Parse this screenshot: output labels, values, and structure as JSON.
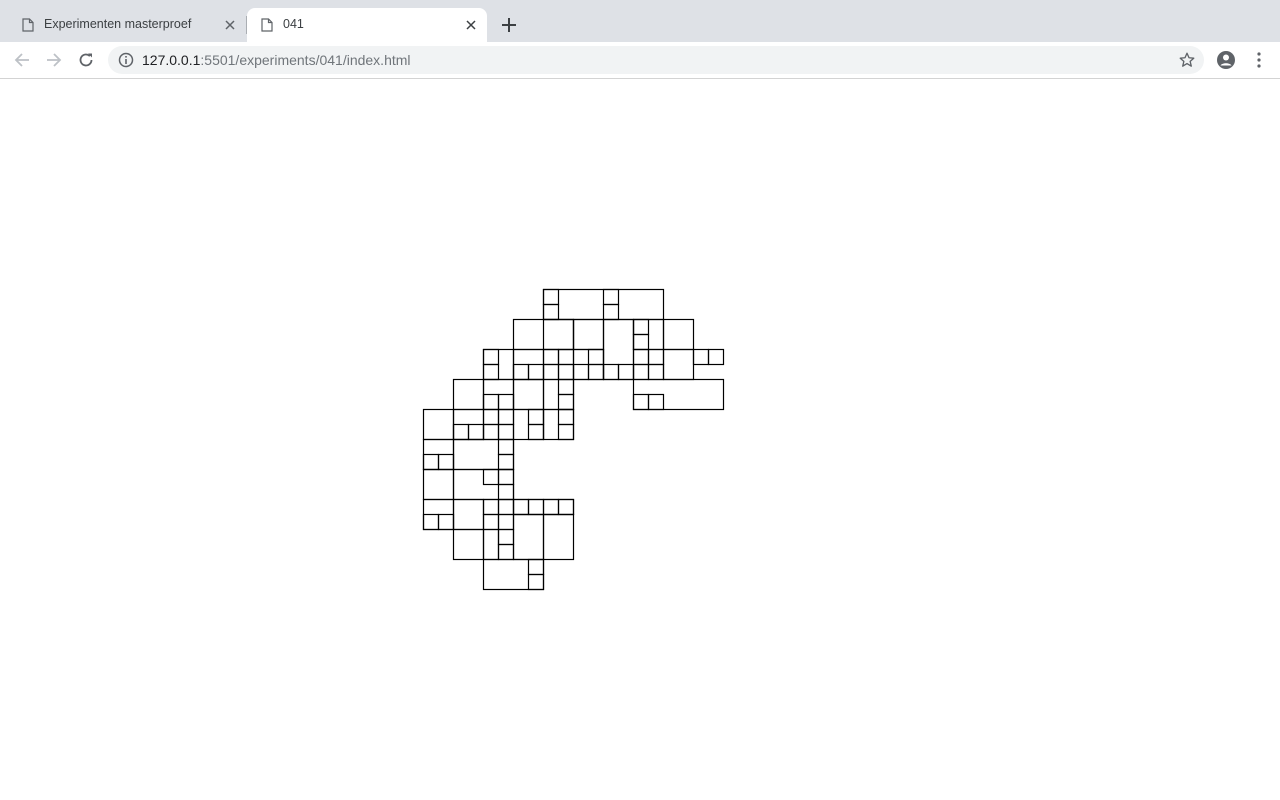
{
  "browser": {
    "tabs": [
      {
        "title": "Experimenten masterproef",
        "active": false,
        "icon": "document-icon"
      },
      {
        "title": "041",
        "active": true,
        "icon": "document-icon"
      }
    ],
    "address_bar": {
      "host": "127.0.0.1",
      "path": ":5501/experiments/041/index.html"
    },
    "icons": {
      "back": "arrow-left-icon",
      "forward": "arrow-right-icon",
      "reload": "reload-icon",
      "site_info": "info-icon",
      "bookmark": "star-icon",
      "profile": "account-icon",
      "menu": "kebab-menu-icon",
      "new_tab": "plus-icon",
      "close_tab": "close-icon"
    },
    "colors": {
      "tab_strip": "#dee1e6",
      "omnibox": "#f1f3f4",
      "stroke": "#000000"
    }
  }
}
